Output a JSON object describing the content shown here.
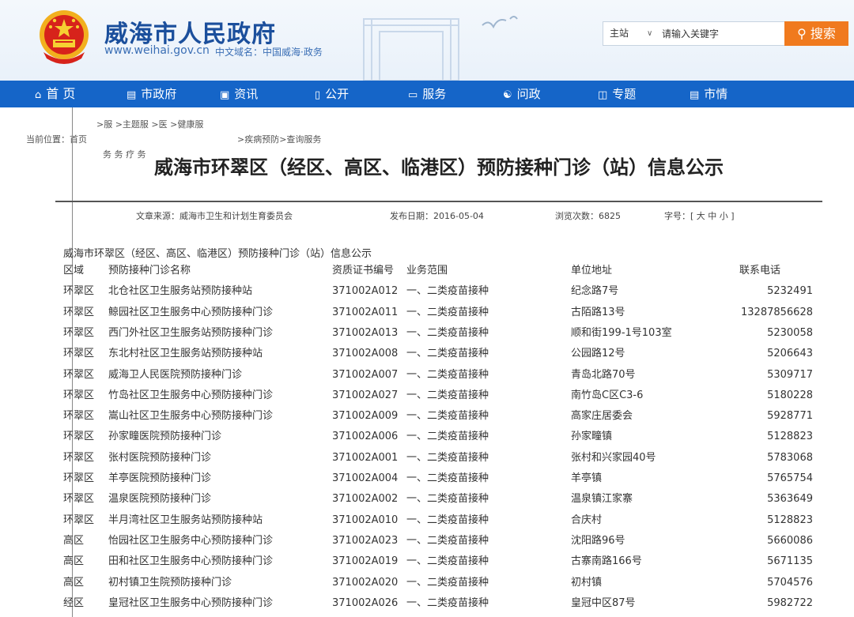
{
  "header": {
    "title": "威海市人民政府",
    "url": "www.weihai.gov.cn",
    "domain": "中文域名：中国威海·政务"
  },
  "search": {
    "scope": "主站",
    "placeholder": "请输入关键字",
    "button": "搜索"
  },
  "nav": [
    {
      "label": "首 页",
      "icon": "home-icon"
    },
    {
      "label": "市政府",
      "icon": "building-icon"
    },
    {
      "label": "资讯",
      "icon": "news-icon"
    },
    {
      "label": "公开",
      "icon": "book-icon"
    },
    {
      "label": "服务",
      "icon": "monitor-icon"
    },
    {
      "label": "问政",
      "icon": "people-icon"
    },
    {
      "label": "专题",
      "icon": "topic-icon"
    },
    {
      "label": "市情",
      "icon": "city-icon"
    }
  ],
  "breadcrumb": {
    "prefix": "当前位置：首页",
    "top": ">服  >主题服  >医  >健康服",
    "mid": ">疾病预防>查询服务",
    "bottom": "务    务       疗    务"
  },
  "article": {
    "title": "威海市环翠区（经区、高区、临港区）预防接种门诊（站）信息公示",
    "source": "文章来源：威海市卫生和计划生育委员会",
    "date": "发布日期：2016-05-04",
    "views": "浏览次数：6825",
    "fontsize": "字号：[ 大 中 小 ]",
    "subtitle": "威海市环翠区（经区、高区、临港区）预防接种门诊（站）信息公示"
  },
  "table": {
    "headers": [
      "区域",
      "预防接种门诊名称",
      "资质证书编号",
      "业务范围",
      "单位地址",
      "联系电话"
    ],
    "rows": [
      [
        "环翠区",
        "北仓社区卫生服务站预防接种站",
        "371002A012",
        "一、二类疫苗接种",
        "纪念路7号",
        "5232491"
      ],
      [
        "环翠区",
        "鲸园社区卫生服务中心预防接种门诊",
        "371002A011",
        "一、二类疫苗接种",
        "古陌路13号",
        "13287856628"
      ],
      [
        "环翠区",
        "西门外社区卫生服务站预防接种门诊",
        "371002A013",
        "一、二类疫苗接种",
        "顺和街199-1号103室",
        "5230058"
      ],
      [
        "环翠区",
        "东北村社区卫生服务站预防接种站",
        "371002A008",
        "一、二类疫苗接种",
        "公园路12号",
        "5206643"
      ],
      [
        "环翠区",
        "威海卫人民医院预防接种门诊",
        "371002A007",
        "一、二类疫苗接种",
        "青岛北路70号",
        "5309717"
      ],
      [
        "环翠区",
        "竹岛社区卫生服务中心预防接种门诊",
        "371002A027",
        "一、二类疫苗接种",
        "南竹岛C区C3-6",
        "5180228"
      ],
      [
        "环翠区",
        "嵩山社区卫生服务中心预防接种门诊",
        "371002A009",
        "一、二类疫苗接种",
        "高家庄居委会",
        "5928771"
      ],
      [
        "环翠区",
        "孙家疃医院预防接种门诊",
        "371002A006",
        "一、二类疫苗接种",
        "孙家疃镇",
        "5128823"
      ],
      [
        "环翠区",
        "张村医院预防接种门诊",
        "371002A001",
        "一、二类疫苗接种",
        "张村和兴家园40号",
        "5783068"
      ],
      [
        "环翠区",
        "羊亭医院预防接种门诊",
        "371002A004",
        "一、二类疫苗接种",
        "羊亭镇",
        "5765754"
      ],
      [
        "环翠区",
        "温泉医院预防接种门诊",
        "371002A002",
        "一、二类疫苗接种",
        "温泉镇江家寨",
        "5363649"
      ],
      [
        "环翠区",
        "半月湾社区卫生服务站预防接种站",
        "371002A010",
        "一、二类疫苗接种",
        "合庆村",
        "5128823"
      ],
      [
        "高区",
        "怡园社区卫生服务中心预防接种门诊",
        "371002A023",
        "一、二类疫苗接种",
        "沈阳路96号",
        "5660086"
      ],
      [
        "高区",
        "田和社区卫生服务中心预防接种门诊",
        "371002A019",
        "一、二类疫苗接种",
        "古寨南路166号",
        "5671135"
      ],
      [
        "高区",
        "初村镇卫生院预防接种门诊",
        "371002A020",
        "一、二类疫苗接种",
        "初村镇",
        "5704576"
      ],
      [
        "经区",
        "皇冠社区卫生服务中心预防接种门诊",
        "371002A026",
        "一、二类疫苗接种",
        "皇冠中区87号",
        "5982722"
      ]
    ]
  },
  "colors": {
    "nav_bg": "#1565c8",
    "search_button": "#f07a1e",
    "title_blue": "#1b4f9c"
  }
}
